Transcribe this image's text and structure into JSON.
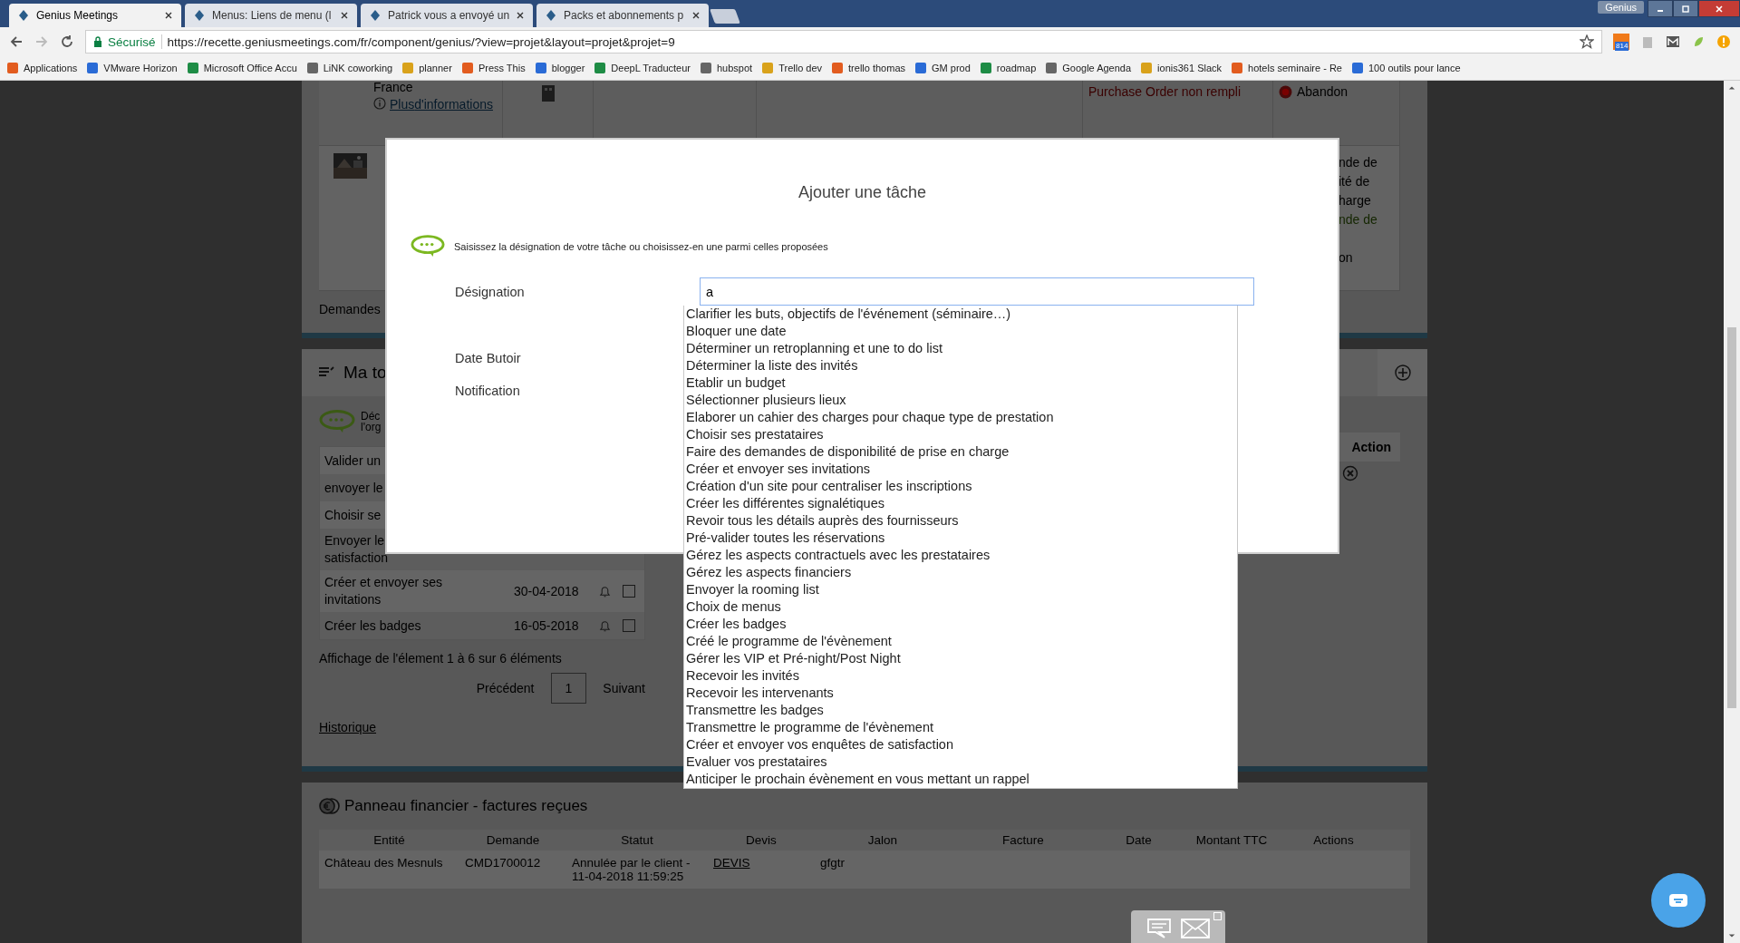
{
  "browser": {
    "tabs": [
      {
        "title": "Genius Meetings",
        "selected": true
      },
      {
        "title": "Menus: Liens de menu (l",
        "selected": false
      },
      {
        "title": "Patrick vous a envoyé un",
        "selected": false
      },
      {
        "title": "Packs et abonnements p",
        "selected": false
      }
    ],
    "profile": "Genius",
    "security": "Sécurisé",
    "url": "https://recette.geniusmeetings.com/fr/component/genius/?view=projet&layout=projet&projet=9",
    "extension_badge": "814",
    "bookmarks": [
      "Applications",
      "VMware Horizon",
      "Microsoft Office Accu",
      "LiNK coworking",
      "planner",
      "Press This",
      "blogger",
      "DeepL Traducteur",
      "hubspot",
      "Trello dev",
      "trello thomas",
      "GM prod",
      "roadmap",
      "Google Agenda",
      "ionis361 Slack",
      "hotels seminaire - Re",
      "100 outils pour lance"
    ]
  },
  "project_panel": {
    "location": "France",
    "more_info": [
      "Plus",
      "d'informations"
    ],
    "status_note": "Purchase Order non rempli",
    "status": "Abandon",
    "fragments": [
      {
        "text": "nde de",
        "kind": "plain"
      },
      {
        "text": "ité de",
        "kind": "plain"
      },
      {
        "text": "harge",
        "kind": "plain"
      },
      {
        "text": "nde de",
        "kind": "link"
      },
      {
        "text": "on",
        "kind": "plain"
      }
    ],
    "requests_label": "Demandes"
  },
  "tasks_panel": {
    "title": "Ma to",
    "intro": [
      "Déc",
      "l'org"
    ],
    "rows": [
      {
        "lines": [
          "Valider un"
        ]
      },
      {
        "lines": [
          "envoyer le"
        ]
      },
      {
        "lines": [
          "Choisir se"
        ]
      },
      {
        "lines": [
          "Envoyer le",
          "satisfaction"
        ]
      },
      {
        "lines": [
          "Créer et envoyer ses",
          "invitations"
        ],
        "date": "30-04-2018",
        "checked": false
      },
      {
        "lines": [
          "Créer les badges"
        ],
        "date": "16-05-2018",
        "checked": false
      }
    ],
    "action_header": "Action",
    "summary": "Affichage de l'élement 1 à 6 sur 6 éléments",
    "previous": "Précédent",
    "page": "1",
    "next": "Suivant",
    "history_link": "Historique"
  },
  "finance_panel": {
    "title": "Panneau financier - factures reçues",
    "columns": [
      "Entité",
      "Demande",
      "Statut",
      "Devis",
      "Jalon",
      "Facture",
      "Date",
      "Montant TTC",
      "Actions"
    ],
    "rows": [
      [
        {
          "text": "Château des Mesnuls",
          "kind": "text"
        },
        {
          "text": "CMD1700012",
          "kind": "text"
        },
        {
          "text": "Annulée par le client - 11-04-2018 11:59:25",
          "kind": "text"
        },
        {
          "text": "DEVIS",
          "kind": "link"
        },
        {
          "text": "gfgtr",
          "kind": "text"
        }
      ]
    ]
  },
  "dialog": {
    "title": "Ajouter une tâche",
    "instruction": "Saisissez la désignation de votre tâche ou choisissez-en une parmi celles proposées",
    "fields": [
      {
        "label": "Désignation",
        "value": "a"
      },
      {
        "label": "Date Butoir"
      },
      {
        "label": "Notification"
      }
    ],
    "suggestions": [
      "Clarifier les buts, objectifs de l'événement (séminaire…)",
      "Bloquer une date",
      "Déterminer un retroplanning et une to do list",
      "Déterminer la liste des invités",
      "Etablir un budget",
      "Sélectionner plusieurs lieux",
      "Elaborer un cahier des charges pour chaque type de prestation",
      "Choisir ses prestataires",
      "Faire des demandes de disponibilité de prise en charge",
      "Créer et envoyer ses invitations",
      "Création d'un site pour centraliser les inscriptions",
      "Créer les différentes signalétiques",
      "Revoir tous les détails auprès des fournisseurs",
      "Pré-valider toutes les réservations",
      "Gérez les aspects contractuels avec les prestataires",
      "Gérez les aspects financiers",
      "Envoyer la rooming list",
      "Choix de menus",
      "Créer les badges",
      "Créé le programme de l'évènement",
      "Gérer les VIP et Pré-night/Post Night",
      "Recevoir les invités",
      "Recevoir les intervenants",
      "Transmettre les badges",
      "Transmettre le programme de l'évènement",
      "Créer et envoyer vos enquêtes de satisfaction",
      "Evaluer vos prestataires",
      "Anticiper le prochain évènement en vous mettant un rappel"
    ]
  }
}
